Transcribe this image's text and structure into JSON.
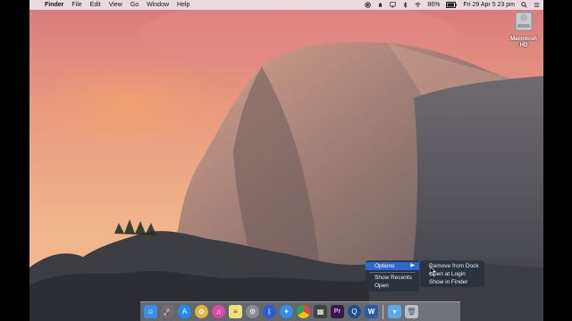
{
  "menubar": {
    "apple": "",
    "app_name": "Finder",
    "menus": [
      "File",
      "Edit",
      "View",
      "Go",
      "Window",
      "Help"
    ],
    "battery": "86%",
    "datetime": "Fri 29 Apr  5 23 pm"
  },
  "desktop": {
    "disk_label_line1": "Macintosh",
    "disk_label_line2": "HD"
  },
  "context_menu": {
    "options_label": "Options",
    "submenu_arrow": "▶",
    "show_recents": "Show Recents",
    "open": "Open"
  },
  "submenu": {
    "remove_from_dock": "Remove from Dock",
    "open_at_login": "Open at Login",
    "show_in_finder": "Show in Finder"
  },
  "dock": {
    "apps": [
      {
        "name": "finder",
        "color": "#3a8ee6"
      },
      {
        "name": "launchpad",
        "color": "#6a6f78"
      },
      {
        "name": "app-store",
        "color": "#1f8ef0"
      },
      {
        "name": "photos",
        "color": "#e9b43a"
      },
      {
        "name": "itunes",
        "color": "#d94ba8"
      },
      {
        "name": "notes",
        "color": "#f2e07a"
      },
      {
        "name": "system-preferences",
        "color": "#8a8d94"
      },
      {
        "name": "bluetooth",
        "color": "#2b5fd1"
      },
      {
        "name": "safari",
        "color": "#2d8ff0"
      },
      {
        "name": "chrome",
        "color": "#e1453b"
      },
      {
        "name": "clapper",
        "color": "#444"
      },
      {
        "name": "premiere",
        "color": "#3a1a4d"
      },
      {
        "name": "quicktime",
        "color": "#1b4f8f"
      },
      {
        "name": "word",
        "color": "#2b5aa8"
      },
      {
        "name": "folder",
        "color": "#5aaae8"
      },
      {
        "name": "trash",
        "color": "#b9c2cc"
      }
    ]
  }
}
